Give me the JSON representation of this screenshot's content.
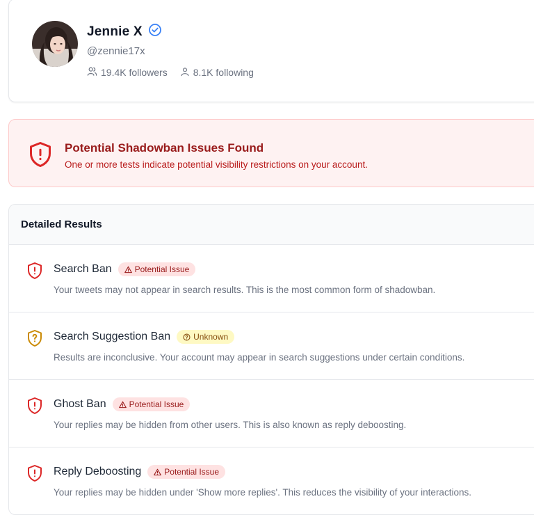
{
  "profile": {
    "name": "Jennie X",
    "handle": "@zennie17x",
    "followers": "19.4K followers",
    "following": "8.1K following"
  },
  "alert": {
    "title": "Potential Shadowban Issues Found",
    "message": "One or more tests indicate potential visibility restrictions on your account."
  },
  "results": {
    "header": "Detailed Results",
    "items": [
      {
        "title": "Search Ban",
        "status": "Potential Issue",
        "description": "Your tweets may not appear in search results. This is the most common form of shadowban."
      },
      {
        "title": "Search Suggestion Ban",
        "status": "Unknown",
        "description": "Results are inconclusive. Your account may appear in search suggestions under certain conditions."
      },
      {
        "title": "Ghost Ban",
        "status": "Potential Issue",
        "description": "Your replies may be hidden from other users. This is also known as reply deboosting."
      },
      {
        "title": "Reply Deboosting",
        "status": "Potential Issue",
        "description": "Your replies may be hidden under 'Show more replies'. This reduces the visibility of your interactions."
      }
    ]
  },
  "colors": {
    "issue": "#dc2626",
    "unknown": "#ca8a04",
    "verified": "#3b82f6"
  },
  "icons": {
    "verified": "verified-badge-icon",
    "followers": "users-icon",
    "following": "user-icon",
    "alert": "shield-alert-icon",
    "issue": "shield-alert-icon",
    "unknown": "shield-question-icon",
    "badge_issue": "warning-triangle-icon",
    "badge_unknown": "question-circle-icon"
  }
}
